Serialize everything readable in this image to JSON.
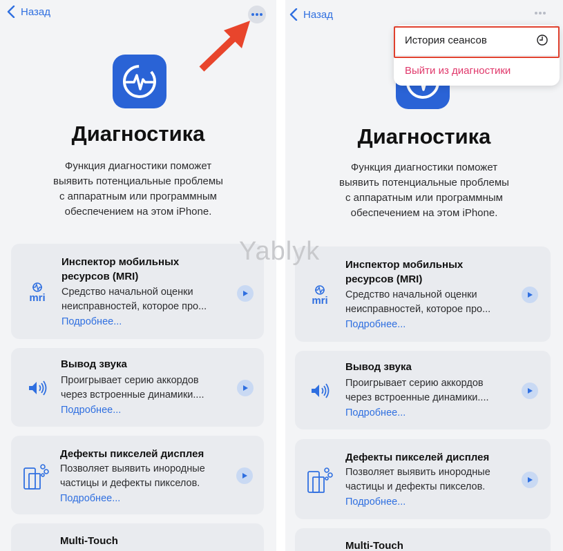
{
  "colors": {
    "accent": "#2f6fe0",
    "app_icon_bg": "#2a63d6",
    "destructive": "#e0386b",
    "highlight": "#e0402d",
    "arrow": "#e8452c"
  },
  "nav": {
    "back_label": "Назад",
    "more_icon": "ellipsis-icon"
  },
  "header": {
    "app_icon": "waveform-circle-icon",
    "title": "Диагностика",
    "description_lines": [
      "Функция диагностики поможет",
      "выявить потенциальные проблемы",
      "с аппаратным или программным",
      "обеспечением на этом iPhone."
    ]
  },
  "cards": [
    {
      "icon": "mri-icon",
      "icon_text": "mri",
      "title_lines": [
        "Инспектор мобильных",
        "ресурсов (MRI)"
      ],
      "desc_lines": [
        "Средство начальной оценки",
        "неисправностей, которое про..."
      ],
      "link": "Подробнее..."
    },
    {
      "icon": "speaker-icon",
      "title_lines": [
        "Вывод звука"
      ],
      "desc_lines": [
        "Проигрывает серию аккордов",
        "через встроенные динамики...."
      ],
      "link": "Подробнее..."
    },
    {
      "icon": "display-pixels-icon",
      "title_lines": [
        "Дефекты пикселей дисплея"
      ],
      "desc_lines": [
        "Позволяет выявить инородные",
        "частицы и дефекты пикселов."
      ],
      "link": "Подробнее..."
    },
    {
      "icon": "multitouch-icon",
      "title_lines": [
        "Multi-Touch"
      ],
      "desc_lines": [],
      "link": ""
    }
  ],
  "menu": {
    "history_label": "История сеансов",
    "history_icon": "clock-icon",
    "exit_label": "Выйти из диагностики"
  },
  "watermark": "Yablyk"
}
